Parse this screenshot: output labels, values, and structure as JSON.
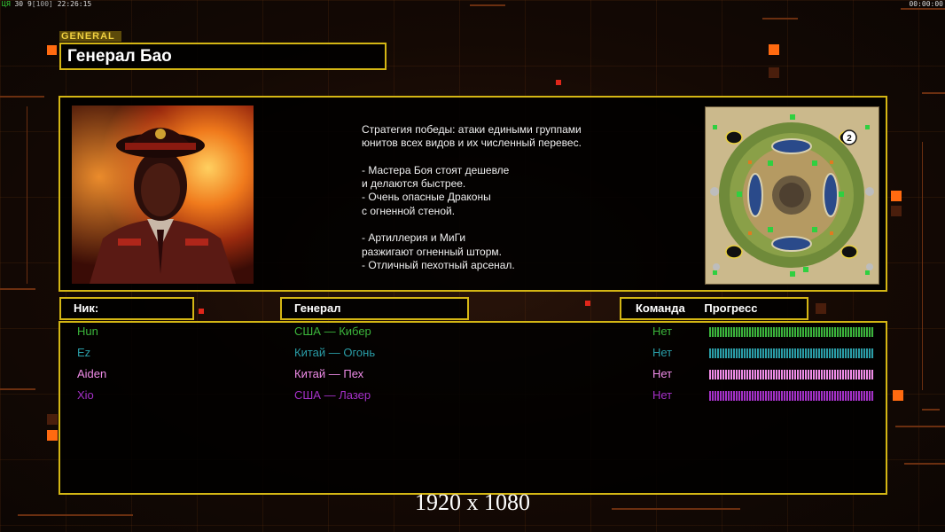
{
  "topbar": {
    "left_ok": "ЦЯ",
    "left_fps": "30",
    "left_ping": "9",
    "left_bracket": "[100]",
    "left_clock": "22:26:15",
    "right_timer": "00:00:00"
  },
  "general": {
    "tag": "GENERAL",
    "name": "Генерал Бао",
    "description": "Стратегия победы: атаки едиными группами\nюнитов всех видов и их численный перевес.\n\n- Мастера Боя стоят дешевле\nи делаются быстрее.\n- Очень опасные Драконы\nс огненной стеной.\n\n- Артиллерия и МиГи\nразжигают огненный шторм.\n- Отличный пехотный арсенал.",
    "portrait_icon": "general-portrait",
    "minimap_icon": "map-preview",
    "minimap_slot_label": "2"
  },
  "table": {
    "headers": {
      "nick": "Ник:",
      "general": "Генерал",
      "team": "Команда",
      "progress": "Прогресс"
    },
    "players": [
      {
        "nick": "Hun",
        "general": "США — Кибер",
        "team": "Нет",
        "color": "#3bb53b",
        "progress": 1.0
      },
      {
        "nick": "Ez",
        "general": "Китай — Огонь",
        "team": "Нет",
        "color": "#2a9ea8",
        "progress": 1.0
      },
      {
        "nick": "Aiden",
        "general": "Китай — Пех",
        "team": "Нет",
        "color": "#f08ce8",
        "progress": 1.0
      },
      {
        "nick": "Xio",
        "general": "США — Лазер",
        "team": "Нет",
        "color": "#a530c8",
        "progress": 1.0
      }
    ]
  },
  "footer": {
    "resolution": "1920 x 1080"
  },
  "colors": {
    "frame": "#d4b614",
    "accent_orange": "#ff6a10"
  }
}
